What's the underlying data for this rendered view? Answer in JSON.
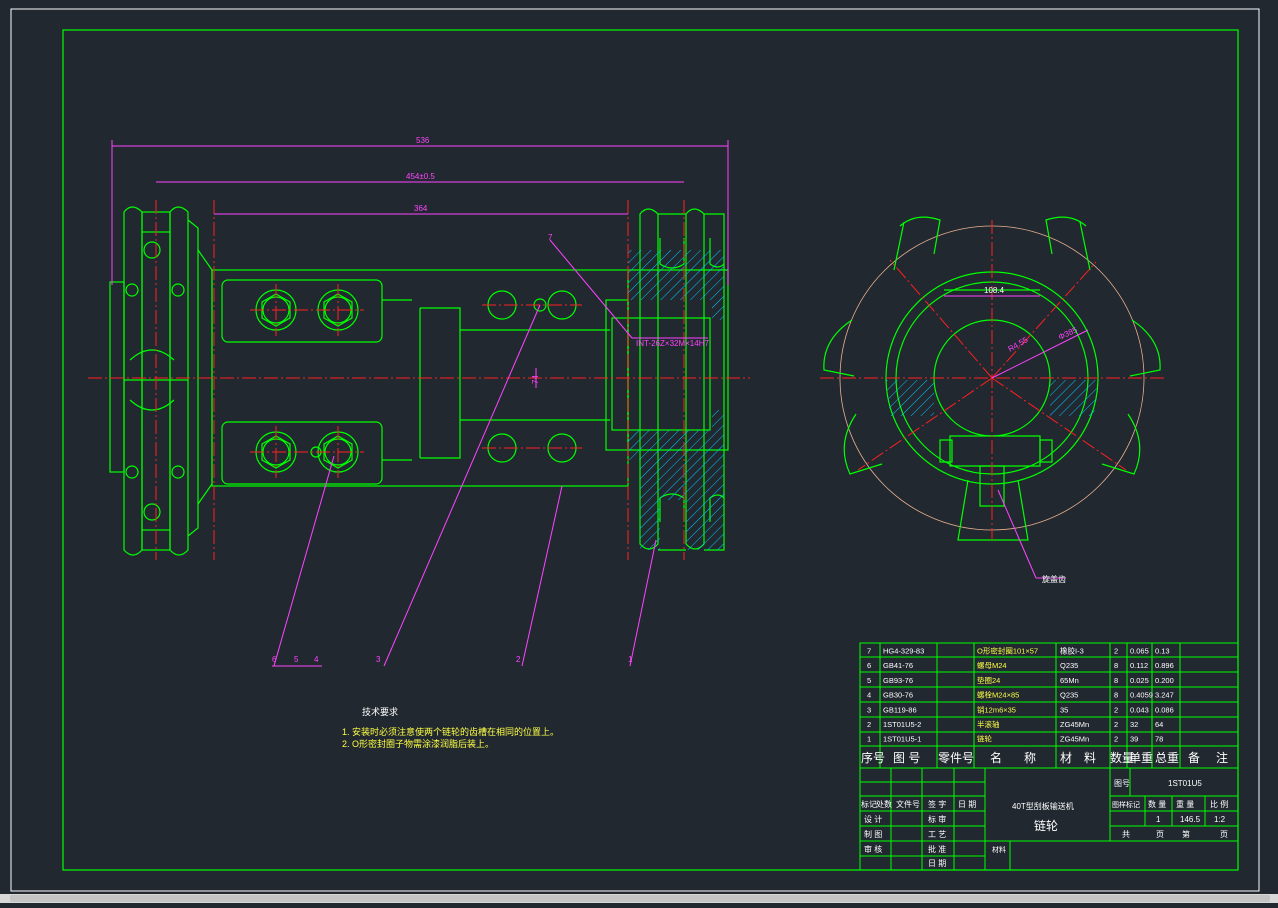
{
  "colors": {
    "background": "#212830",
    "outline": "#00ff00",
    "dimension": "#ff00ff",
    "centerline": "#ff0000",
    "hatch": "#00c8ff",
    "text": "#ffffff",
    "note": "#ffff44"
  },
  "dims": {
    "overall": "536",
    "between": "454±0.5",
    "inner": "364",
    "spline": "INT-26Z×32M×14H7",
    "side": "74",
    "pcd": "108.4",
    "radius": "R4.55",
    "dia": "Φ385"
  },
  "leaders": [
    "7",
    "6",
    "5",
    "4",
    "3",
    "2",
    "1"
  ],
  "side_label": "旋盖齿",
  "tech_req": {
    "title": "技术要求",
    "items": [
      "1. 安装时必须注意使两个链轮的齿槽在相同的位置上。",
      "2. O形密封圈子物需涂漆润脂后装上。"
    ]
  },
  "bom": {
    "rows": [
      {
        "no": "7",
        "code": "HG4-329-83",
        "name": "O形密封圈101×57",
        "material": "橡胶I-3",
        "qty": "2",
        "unit": "0.065",
        "total": "0.13"
      },
      {
        "no": "6",
        "code": "GB41-76",
        "name": "螺母M24",
        "material": "Q235",
        "qty": "8",
        "unit": "0.112",
        "total": "0.896"
      },
      {
        "no": "5",
        "code": "GB93-76",
        "name": "垫圈24",
        "material": "65Mn",
        "qty": "8",
        "unit": "0.025",
        "total": "0.200"
      },
      {
        "no": "4",
        "code": "GB30-76",
        "name": "螺栓M24×85",
        "material": "Q235",
        "qty": "8",
        "unit": "0.4059",
        "total": "3.247"
      },
      {
        "no": "3",
        "code": "GB119-86",
        "name": "销12m6×35",
        "material": "35",
        "qty": "2",
        "unit": "0.043",
        "total": "0.086"
      },
      {
        "no": "2",
        "code": "1ST01U5-2",
        "name": "半滚轴",
        "material": "ZG45Mn",
        "qty": "2",
        "unit": "32",
        "total": "64"
      },
      {
        "no": "1",
        "code": "1ST01U5-1",
        "name": "链轮",
        "material": "ZG45Mn",
        "qty": "2",
        "unit": "39",
        "total": "78"
      }
    ],
    "headers": [
      "序号",
      "图 号",
      "零件号",
      "名",
      "称",
      "材",
      "料",
      "数量",
      "单重",
      "总重",
      "备",
      "注"
    ]
  },
  "title_block": {
    "drawing_no_label": "图号",
    "drawing_no": "1ST01U5",
    "marks": [
      "标记",
      "处数",
      "文件号",
      "签 字",
      "日 期"
    ],
    "roles": [
      "设 计",
      "制 图",
      "审 核"
    ],
    "roles2": [
      "标 审",
      "工 艺",
      "批 准",
      "日 期"
    ],
    "company": "40T型刮板输送机",
    "part": "链轮",
    "material_label": "材料",
    "stage_headers": [
      "图样标记",
      "数 量",
      "重 量",
      "比 例"
    ],
    "stage_values": [
      "1",
      "146.5",
      "1:2"
    ],
    "sheet": [
      "共",
      "页",
      "第",
      "页"
    ]
  }
}
